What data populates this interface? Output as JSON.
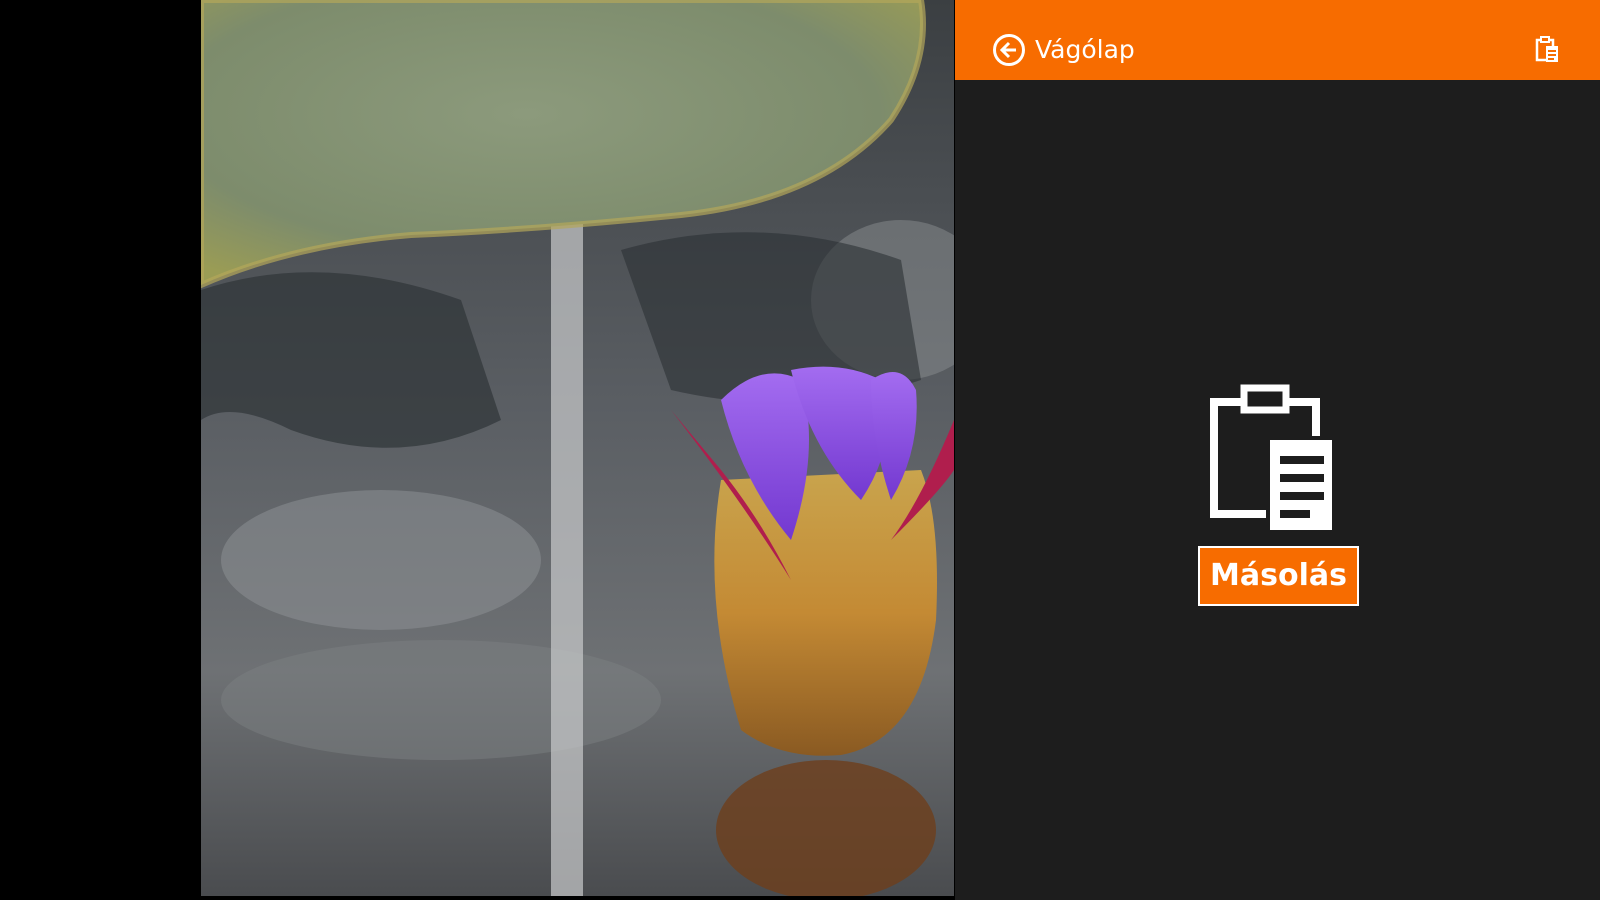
{
  "header": {
    "title": "Vágólap",
    "back_icon": "back-arrow-icon",
    "paste_icon": "clipboard-paste-icon"
  },
  "main": {
    "clipboard_icon": "clipboard-document-icon",
    "copy_label": "Másolás"
  },
  "photo": {
    "subject": "water-lily-bud-photo"
  },
  "colors": {
    "accent": "#f76c00",
    "pane_background": "#1d1d1d",
    "text": "#ffffff"
  }
}
